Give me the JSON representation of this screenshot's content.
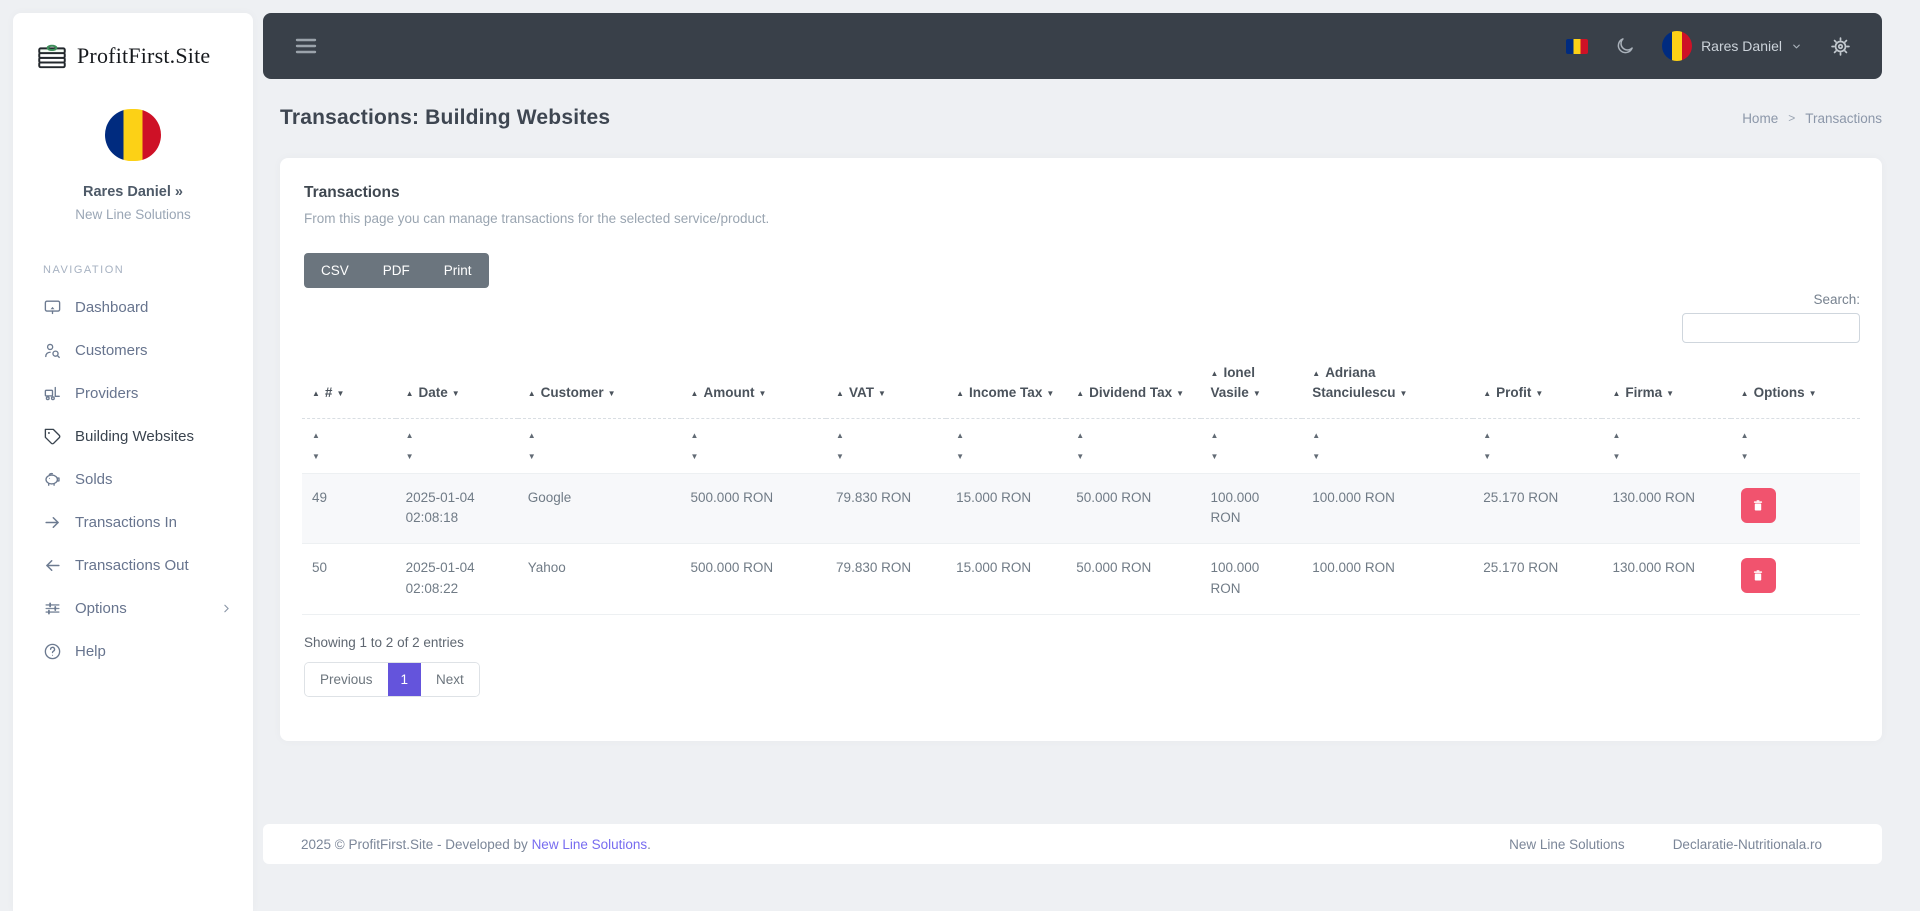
{
  "brand": {
    "name": "ProfitFirst.Site"
  },
  "sidebar": {
    "user_name": "Rares Daniel »",
    "user_company": "New Line Solutions",
    "section_label": "NAVIGATION",
    "items": [
      {
        "label": "Dashboard",
        "icon": "dashboard-icon",
        "active": false
      },
      {
        "label": "Customers",
        "icon": "customers-icon",
        "active": false
      },
      {
        "label": "Providers",
        "icon": "providers-icon",
        "active": false
      },
      {
        "label": "Building Websites",
        "icon": "tag-icon",
        "active": true
      },
      {
        "label": "Solds",
        "icon": "piggy-bank-icon",
        "active": false
      },
      {
        "label": "Transactions In",
        "icon": "arrow-right-icon",
        "active": false
      },
      {
        "label": "Transactions Out",
        "icon": "arrow-left-icon",
        "active": false
      },
      {
        "label": "Options",
        "icon": "sliders-icon",
        "active": false,
        "has_submenu": true
      },
      {
        "label": "Help",
        "icon": "help-icon",
        "active": false
      }
    ]
  },
  "topbar": {
    "user_label": "Rares Daniel",
    "icons": [
      "menu-icon",
      "romania-flag-icon",
      "moon-icon",
      "user-avatar-flag",
      "caret-down-icon",
      "gear-icon"
    ]
  },
  "page": {
    "title": "Transactions: Building Websites",
    "breadcrumb": {
      "home": "Home",
      "separator": ">",
      "current": "Transactions"
    }
  },
  "card": {
    "title": "Transactions",
    "subtitle": "From this page you can manage transactions for the selected service/product.",
    "export_buttons": {
      "csv": "CSV",
      "pdf": "PDF",
      "print": "Print"
    },
    "search_label": "Search:",
    "search_value": ""
  },
  "table": {
    "sort_asc_glyph": "▲",
    "sort_desc_glyph": "▼",
    "columns": [
      "#",
      "Date",
      "Customer",
      "Amount",
      "VAT",
      "Income Tax",
      "Dividend Tax",
      "Ionel Vasile",
      "Adriana Stanciulescu",
      "Profit",
      "Firma",
      "Options"
    ],
    "rows": [
      [
        "49",
        "2025-01-04 02:08:18",
        "Google",
        "500.000 RON",
        "79.830 RON",
        "15.000 RON",
        "50.000 RON",
        "100.000 RON",
        "100.000 RON",
        "25.170 RON",
        "130.000 RON"
      ],
      [
        "50",
        "2025-01-04 02:08:22",
        "Yahoo",
        "500.000 RON",
        "79.830 RON",
        "15.000 RON",
        "50.000 RON",
        "100.000 RON",
        "100.000 RON",
        "25.170 RON",
        "130.000 RON"
      ]
    ],
    "row_action_icon": "trash-icon"
  },
  "table_footer": {
    "showing_text": "Showing 1 to 2 of 2 entries",
    "pagination": {
      "previous": "Previous",
      "page": "1",
      "next": "Next"
    }
  },
  "footer": {
    "copyright_prefix": "2025 © ProfitFirst.Site - Developed by ",
    "copyright_link": "New Line Solutions",
    "copyright_suffix": ".",
    "links": [
      "New Line Solutions",
      "Declaratie-Nutritionala.ro"
    ]
  },
  "colors": {
    "navbar_bg": "#394049",
    "danger": "#f1536e",
    "pagination_active": "#6454dc",
    "footer_link": "#776cf0",
    "flag_blue": "#002b7f",
    "flag_yellow": "#fcd116",
    "flag_red": "#ce1126"
  }
}
